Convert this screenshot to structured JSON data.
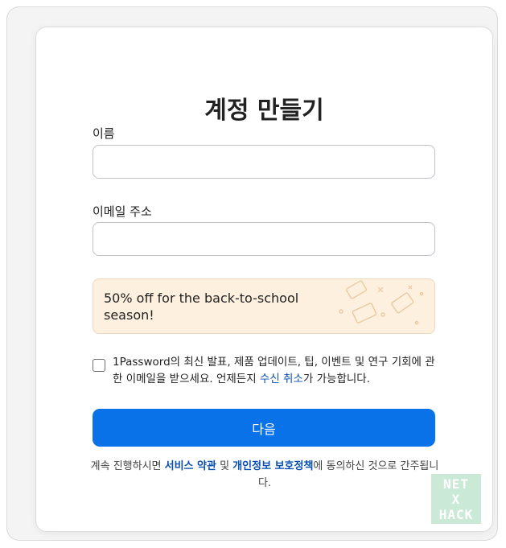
{
  "page": {
    "title": "계정 만들기"
  },
  "form": {
    "name_label": "이름",
    "name_value": "",
    "email_label": "이메일 주소",
    "email_value": ""
  },
  "promo": {
    "text": "50% off for the back-to-school season!",
    "accent_color": "#fdf0de"
  },
  "consent": {
    "text_before": "1Password의 최신 발표, 제품 업데이트, 팁, 이벤트 및 연구 기회에 관한 이메일을 받으세요. 언제든지 ",
    "unsubscribe_link": "수신 취소",
    "text_after": "가 가능합니다."
  },
  "actions": {
    "next_label": "다음",
    "button_color": "#0a72e9"
  },
  "terms": {
    "prefix": "계속 진행하시면 ",
    "service_link": "서비스 약관",
    "and": " 및 ",
    "privacy_link": "개인정보 보호정책",
    "suffix": "에 동의하신 것으로 간주됩니다."
  },
  "watermark": {
    "line1": "NET",
    "line2": "X",
    "line3": "HACK"
  }
}
